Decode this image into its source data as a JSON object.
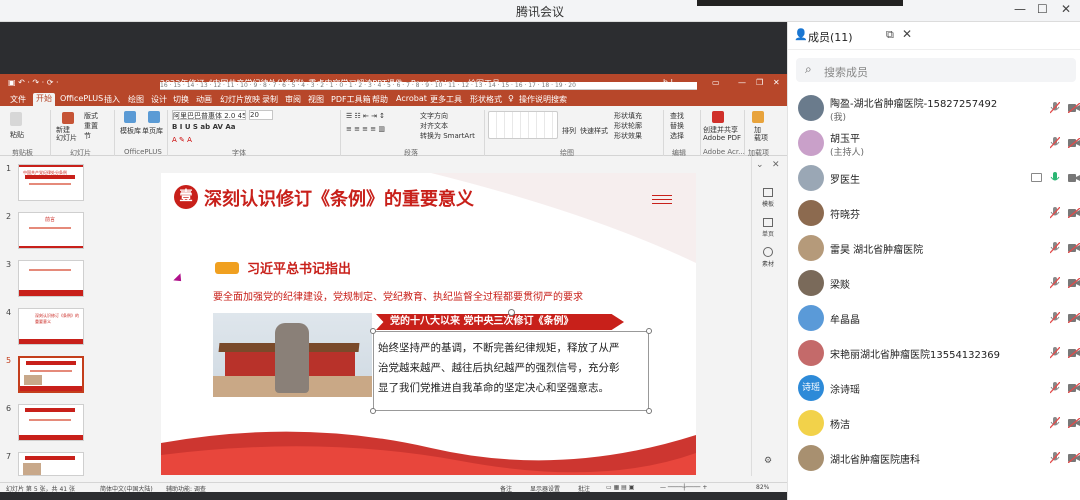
{
  "window": {
    "title": "腾讯会议"
  },
  "ppt": {
    "title": "2023年修订《中国共产党纪律处分条例》重点内容学习解读PPT课件 - PowerPoint",
    "tool_tab": "绘图工具",
    "user": "b l",
    "tabs": [
      "文件",
      "开始",
      "OfficePLUS",
      "插入",
      "绘图",
      "设计",
      "切换",
      "动画",
      "幻灯片放映",
      "录制",
      "审阅",
      "视图",
      "PDF工具箱",
      "帮助",
      "Acrobat",
      "更多工具",
      "形状格式",
      "操作说明搜索"
    ],
    "ribbon": {
      "paste": "粘贴",
      "new_slide": "新建\n幻灯片",
      "layout": "版式",
      "reset": "重置",
      "section": "节",
      "template": "模板库",
      "single": "单页库",
      "font_name": "阿里巴巴普惠体 2.0 45 L",
      "font_size": "20",
      "text_dir": "文字方向",
      "align_text": "对齐文本",
      "smartart": "转换为 SmartArt",
      "arrange": "排列",
      "quick_style": "快速样式",
      "fill": "形状填充",
      "outline": "形状轮廓",
      "effect": "形状效果",
      "find": "查找",
      "replace": "替换",
      "select": "选择",
      "share_pdf": "创建并共享\nAdobe PDF",
      "addin": "加\n载项",
      "groups": [
        "剪贴板",
        "幻灯片",
        "OfficePLUS",
        "字体",
        "段落",
        "绘图",
        "编辑",
        "Adobe Acr...",
        "加载项"
      ]
    },
    "ruler": "16 · 15 · 14 · 13 · 12 · 11 · 10 · 9 · 8 · 7 · 6 · 5 · 4 · 3 · 2 · 1 · 0 · 1 · 2 · 3 · 4 · 5 · 6 · 7 · 8 · 9 · 10 · 11 · 12 · 13 · 14 · 15 · 16 · 17 · 18 · 19 · 20",
    "thumbs": [
      "1",
      "2",
      "3",
      "4",
      "5",
      "6",
      "7"
    ],
    "thumb_texts": [
      "中国共产党纪律处分条例",
      "前言",
      "",
      "深刻认识修订《条例》的重要意义",
      "",
      "",
      ""
    ],
    "right_pane": [
      "模板",
      "单页",
      "素材"
    ],
    "slide": {
      "badge": "壹",
      "heading": "深刻认识修订《条例》的重要意义",
      "sub_heading": "习近平总书记指出",
      "quote": "要全面加强党的纪律建设，党规制定、党纪教育、执纪监督全过程都要贯彻严的要求",
      "banner": "党的十八大以来 党中央三次修订《条例》",
      "body": [
        "始终坚持严的基调，不断完善纪律规矩，释放了从严",
        "治党越来越严、越往后执纪越严的强烈信号，充分彰",
        "显了我们党推进自我革命的坚定决心和坚强意志。"
      ]
    },
    "status": {
      "slide": "幻灯片 第 5 张，共 41 张",
      "lang": "简体中文(中国大陆)",
      "access": "辅助功能: 调查",
      "notes": "备注",
      "display": "显示器设置",
      "comments": "批注",
      "zoom": "82%"
    }
  },
  "members": {
    "title": "成员(11)",
    "search_placeholder": "搜索成员",
    "list": [
      {
        "name": "陶盈-湖北省肿瘤医院-15827257492",
        "sub": "(我)",
        "avatar": "#6a7b8c"
      },
      {
        "name": "胡玉平",
        "sub": "(主持人)",
        "avatar": "#c9a0c9"
      },
      {
        "name": "罗医生",
        "sub": "",
        "avatar": "#9aa7b5"
      },
      {
        "name": "符晓芬",
        "sub": "",
        "avatar": "#8c6a4f"
      },
      {
        "name": "雷昊 湖北省肿瘤医院",
        "sub": "",
        "avatar": "#b59a7a"
      },
      {
        "name": "梁赕",
        "sub": "",
        "avatar": "#7a6a5a"
      },
      {
        "name": "牟晶晶",
        "sub": "",
        "avatar": "#5a9ad8"
      },
      {
        "name": "宋艳丽湖北省肿瘤医院13554132369",
        "sub": "",
        "avatar": "#c46a6a"
      },
      {
        "name": "涂诗瑶",
        "sub": "",
        "avatar": "#2d8ad8",
        "initials": "诗瑶"
      },
      {
        "name": "杨洁",
        "sub": "",
        "avatar": "#f2d24a"
      },
      {
        "name": "湖北省肿瘤医院唐科",
        "sub": "",
        "avatar": "#a89070"
      }
    ]
  },
  "colors": {
    "ppt_red": "#b7472a",
    "slide_red": "#c8201a",
    "muted_mic": "#e24b4b",
    "green": "#2bb673"
  }
}
